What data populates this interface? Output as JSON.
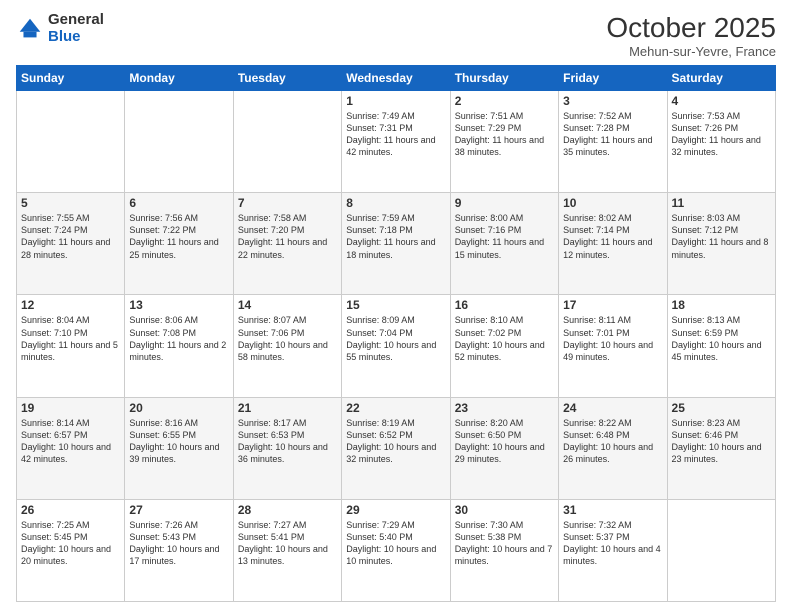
{
  "logo": {
    "general": "General",
    "blue": "Blue"
  },
  "header": {
    "month": "October 2025",
    "location": "Mehun-sur-Yevre, France"
  },
  "days_of_week": [
    "Sunday",
    "Monday",
    "Tuesday",
    "Wednesday",
    "Thursday",
    "Friday",
    "Saturday"
  ],
  "weeks": [
    [
      {
        "day": "",
        "info": ""
      },
      {
        "day": "",
        "info": ""
      },
      {
        "day": "",
        "info": ""
      },
      {
        "day": "1",
        "info": "Sunrise: 7:49 AM\nSunset: 7:31 PM\nDaylight: 11 hours\nand 42 minutes."
      },
      {
        "day": "2",
        "info": "Sunrise: 7:51 AM\nSunset: 7:29 PM\nDaylight: 11 hours\nand 38 minutes."
      },
      {
        "day": "3",
        "info": "Sunrise: 7:52 AM\nSunset: 7:28 PM\nDaylight: 11 hours\nand 35 minutes."
      },
      {
        "day": "4",
        "info": "Sunrise: 7:53 AM\nSunset: 7:26 PM\nDaylight: 11 hours\nand 32 minutes."
      }
    ],
    [
      {
        "day": "5",
        "info": "Sunrise: 7:55 AM\nSunset: 7:24 PM\nDaylight: 11 hours\nand 28 minutes."
      },
      {
        "day": "6",
        "info": "Sunrise: 7:56 AM\nSunset: 7:22 PM\nDaylight: 11 hours\nand 25 minutes."
      },
      {
        "day": "7",
        "info": "Sunrise: 7:58 AM\nSunset: 7:20 PM\nDaylight: 11 hours\nand 22 minutes."
      },
      {
        "day": "8",
        "info": "Sunrise: 7:59 AM\nSunset: 7:18 PM\nDaylight: 11 hours\nand 18 minutes."
      },
      {
        "day": "9",
        "info": "Sunrise: 8:00 AM\nSunset: 7:16 PM\nDaylight: 11 hours\nand 15 minutes."
      },
      {
        "day": "10",
        "info": "Sunrise: 8:02 AM\nSunset: 7:14 PM\nDaylight: 11 hours\nand 12 minutes."
      },
      {
        "day": "11",
        "info": "Sunrise: 8:03 AM\nSunset: 7:12 PM\nDaylight: 11 hours\nand 8 minutes."
      }
    ],
    [
      {
        "day": "12",
        "info": "Sunrise: 8:04 AM\nSunset: 7:10 PM\nDaylight: 11 hours\nand 5 minutes."
      },
      {
        "day": "13",
        "info": "Sunrise: 8:06 AM\nSunset: 7:08 PM\nDaylight: 11 hours\nand 2 minutes."
      },
      {
        "day": "14",
        "info": "Sunrise: 8:07 AM\nSunset: 7:06 PM\nDaylight: 10 hours\nand 58 minutes."
      },
      {
        "day": "15",
        "info": "Sunrise: 8:09 AM\nSunset: 7:04 PM\nDaylight: 10 hours\nand 55 minutes."
      },
      {
        "day": "16",
        "info": "Sunrise: 8:10 AM\nSunset: 7:02 PM\nDaylight: 10 hours\nand 52 minutes."
      },
      {
        "day": "17",
        "info": "Sunrise: 8:11 AM\nSunset: 7:01 PM\nDaylight: 10 hours\nand 49 minutes."
      },
      {
        "day": "18",
        "info": "Sunrise: 8:13 AM\nSunset: 6:59 PM\nDaylight: 10 hours\nand 45 minutes."
      }
    ],
    [
      {
        "day": "19",
        "info": "Sunrise: 8:14 AM\nSunset: 6:57 PM\nDaylight: 10 hours\nand 42 minutes."
      },
      {
        "day": "20",
        "info": "Sunrise: 8:16 AM\nSunset: 6:55 PM\nDaylight: 10 hours\nand 39 minutes."
      },
      {
        "day": "21",
        "info": "Sunrise: 8:17 AM\nSunset: 6:53 PM\nDaylight: 10 hours\nand 36 minutes."
      },
      {
        "day": "22",
        "info": "Sunrise: 8:19 AM\nSunset: 6:52 PM\nDaylight: 10 hours\nand 32 minutes."
      },
      {
        "day": "23",
        "info": "Sunrise: 8:20 AM\nSunset: 6:50 PM\nDaylight: 10 hours\nand 29 minutes."
      },
      {
        "day": "24",
        "info": "Sunrise: 8:22 AM\nSunset: 6:48 PM\nDaylight: 10 hours\nand 26 minutes."
      },
      {
        "day": "25",
        "info": "Sunrise: 8:23 AM\nSunset: 6:46 PM\nDaylight: 10 hours\nand 23 minutes."
      }
    ],
    [
      {
        "day": "26",
        "info": "Sunrise: 7:25 AM\nSunset: 5:45 PM\nDaylight: 10 hours\nand 20 minutes."
      },
      {
        "day": "27",
        "info": "Sunrise: 7:26 AM\nSunset: 5:43 PM\nDaylight: 10 hours\nand 17 minutes."
      },
      {
        "day": "28",
        "info": "Sunrise: 7:27 AM\nSunset: 5:41 PM\nDaylight: 10 hours\nand 13 minutes."
      },
      {
        "day": "29",
        "info": "Sunrise: 7:29 AM\nSunset: 5:40 PM\nDaylight: 10 hours\nand 10 minutes."
      },
      {
        "day": "30",
        "info": "Sunrise: 7:30 AM\nSunset: 5:38 PM\nDaylight: 10 hours\nand 7 minutes."
      },
      {
        "day": "31",
        "info": "Sunrise: 7:32 AM\nSunset: 5:37 PM\nDaylight: 10 hours\nand 4 minutes."
      },
      {
        "day": "",
        "info": ""
      }
    ]
  ]
}
